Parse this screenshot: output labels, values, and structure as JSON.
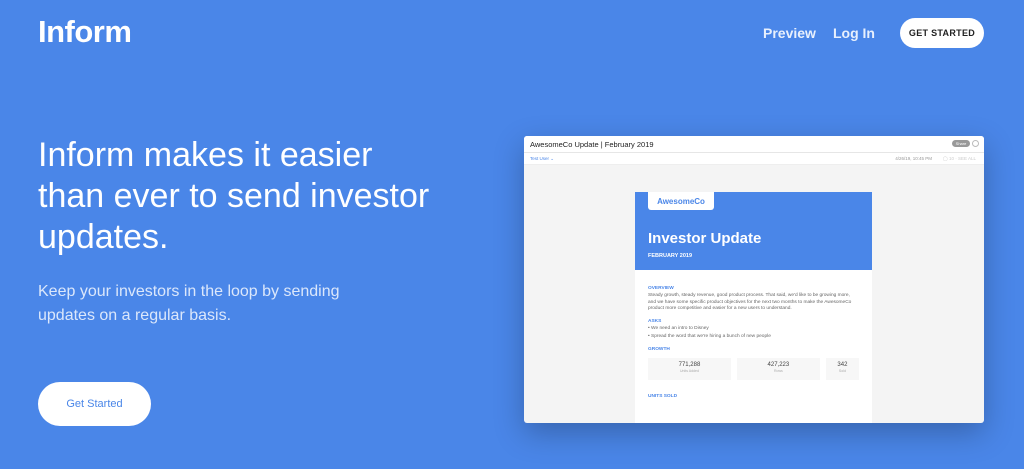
{
  "header": {
    "logo": "Inform",
    "nav": {
      "preview": "Preview",
      "login": "Log In",
      "cta": "GET STARTED"
    }
  },
  "hero": {
    "title": "Inform makes it easier than ever to send investor updates.",
    "subtitle": "Keep your investors in the loop by sending updates on a regular basis.",
    "button": "Get Started"
  },
  "preview": {
    "window_title": "AwesomeCo Update | February 2019",
    "pill": "Share",
    "user": "Test User ⌄",
    "date": "4/26/19, 10:45 PM",
    "extra": "◯ 10 · SEE ALL",
    "email": {
      "brand": "AwesomeCo",
      "title": "Investor Update",
      "date": "FEBRUARY 2019",
      "overview_h": "OVERVIEW",
      "overview_t": "Steady growth, steady revenue, good product process. That said, we'd like to be growing more, and we have some specific product objectives for the next two months to make the AwesomeCo product more competitive and easier for a new users to understand.",
      "asks_h": "ASKS",
      "asks_1": "• We need an intro to Disney",
      "asks_2": "• Spread the word that we're hiring a bunch of new people",
      "growth_h": "GROWTH",
      "stats": [
        {
          "value": "771,288",
          "label": "Units Added"
        },
        {
          "value": "427,223",
          "label": "Rows"
        },
        {
          "value": "342",
          "label": "Sold"
        }
      ],
      "units_h": "UNITS SOLD"
    }
  },
  "colors": {
    "accent": "#4a86e8"
  }
}
